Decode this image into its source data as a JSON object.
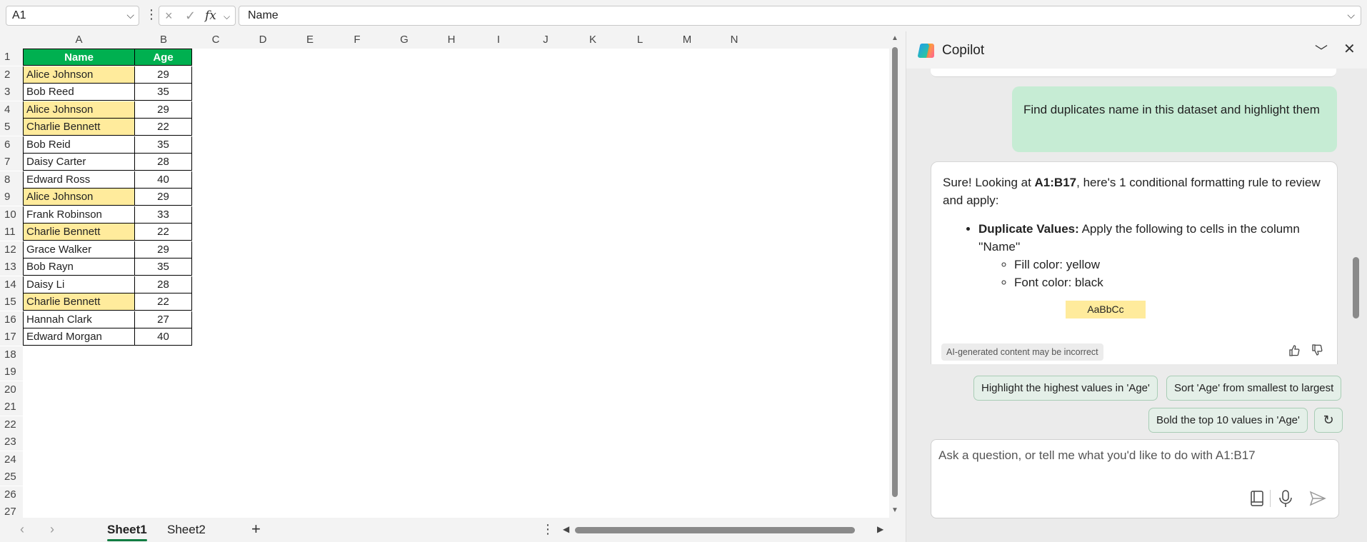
{
  "formula_bar": {
    "name_box": "A1",
    "cancel_icon": "×",
    "enter_icon": "✓",
    "fx_label": "fx",
    "formula": "Name"
  },
  "grid": {
    "columns": [
      "A",
      "B",
      "C",
      "D",
      "E",
      "F",
      "G",
      "H",
      "I",
      "J",
      "K",
      "L",
      "M",
      "N"
    ],
    "row_numbers": [
      "1",
      "2",
      "3",
      "4",
      "5",
      "6",
      "7",
      "8",
      "9",
      "10",
      "11",
      "12",
      "13",
      "14",
      "15",
      "16",
      "17",
      "18",
      "19",
      "20",
      "21",
      "22",
      "23",
      "24",
      "25",
      "26",
      "27"
    ],
    "headers": {
      "name": "Name",
      "age": "Age"
    },
    "rows": [
      {
        "name": "Alice Johnson",
        "age": "29",
        "duplicate": true
      },
      {
        "name": "Bob Reed",
        "age": "35",
        "duplicate": false
      },
      {
        "name": "Alice Johnson",
        "age": "29",
        "duplicate": true
      },
      {
        "name": "Charlie Bennett",
        "age": "22",
        "duplicate": true
      },
      {
        "name": "Bob Reid",
        "age": "35",
        "duplicate": false
      },
      {
        "name": "Daisy Carter",
        "age": "28",
        "duplicate": false
      },
      {
        "name": "Edward Ross",
        "age": "40",
        "duplicate": false
      },
      {
        "name": "Alice Johnson",
        "age": "29",
        "duplicate": true
      },
      {
        "name": "Frank Robinson",
        "age": "33",
        "duplicate": false
      },
      {
        "name": "Charlie Bennett",
        "age": "22",
        "duplicate": true
      },
      {
        "name": "Grace Walker",
        "age": "29",
        "duplicate": false
      },
      {
        "name": "Bob Rayn",
        "age": "35",
        "duplicate": false
      },
      {
        "name": "Daisy Li",
        "age": "28",
        "duplicate": false
      },
      {
        "name": "Charlie Bennett",
        "age": "22",
        "duplicate": true
      },
      {
        "name": "Hannah Clark",
        "age": "27",
        "duplicate": false
      },
      {
        "name": "Edward Morgan",
        "age": "40",
        "duplicate": false
      }
    ]
  },
  "sheet_tabs": {
    "tabs": [
      "Sheet1",
      "Sheet2"
    ],
    "active": "Sheet1",
    "add_label": "+"
  },
  "copilot": {
    "title": "Copilot",
    "user_message": "Find duplicates name in this dataset and highlight them",
    "ai_message": {
      "intro_prefix": "Sure! Looking at ",
      "intro_range": "A1:B17",
      "intro_suffix": ", here's 1 conditional formatting rule to review and apply:",
      "rule_title": "Duplicate Values:",
      "rule_text": " Apply the following to cells in the column ''Name''",
      "sub_items": [
        "Fill color: yellow",
        "Font color: black"
      ],
      "preview_text": "AaBbCc",
      "disclaimer": "AI-generated content may be incorrect"
    },
    "suggestions": [
      "Highlight the highest values in 'Age'",
      "Sort 'Age' from smallest to largest",
      "Bold the top 10 values in 'Age'"
    ],
    "composer_placeholder": "Ask a question, or tell me what you'd like to do with A1:B17"
  },
  "colors": {
    "header_fill": "#00b050",
    "duplicate_fill": "#ffeb9c",
    "user_bubble": "#c6ecd4",
    "accent": "#107c41"
  }
}
